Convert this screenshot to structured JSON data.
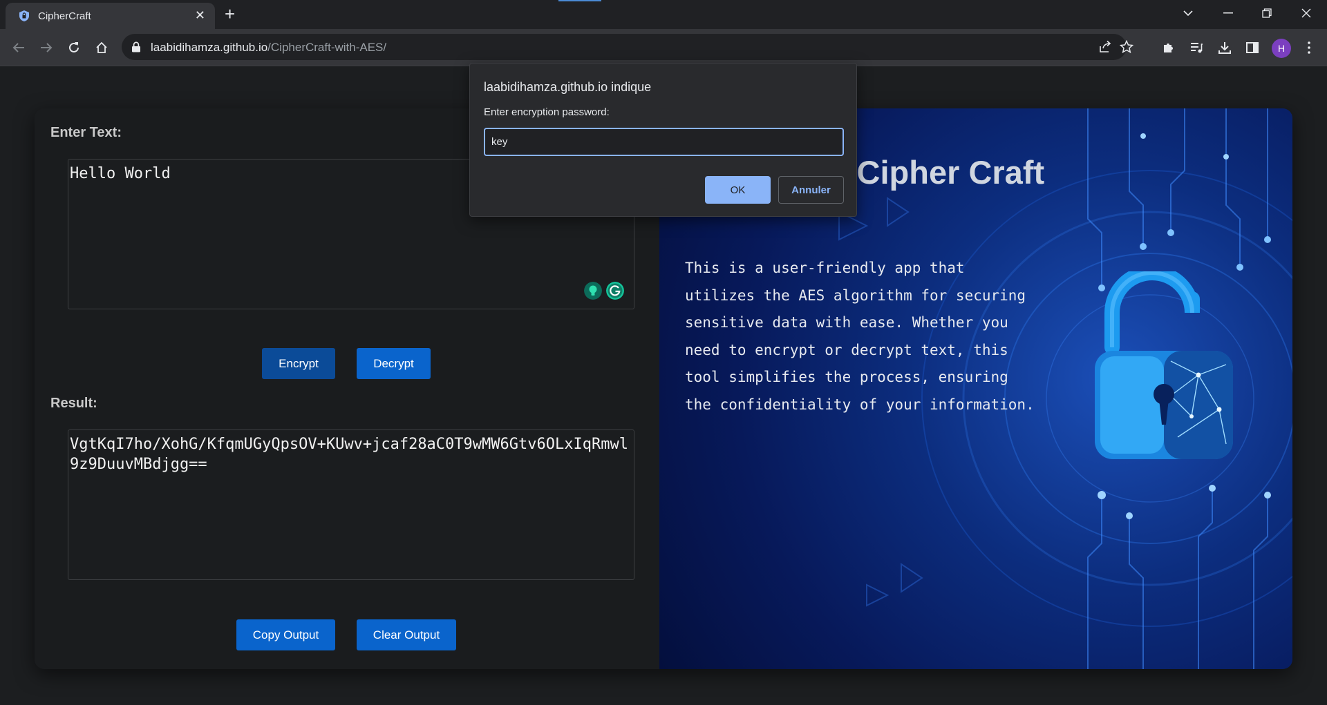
{
  "browser": {
    "tab_title": "CipherCraft",
    "url_host": "laabidihamza.github.io",
    "url_path": "/CipherCraft-with-AES/",
    "profile_initial": "H"
  },
  "app": {
    "input_label": "Enter Text:",
    "input_value": "Hello World",
    "encrypt_label": "Encrypt",
    "decrypt_label": "Decrypt",
    "result_label": "Result:",
    "result_value": "VgtKqI7ho/XohG/KfqmUGyQpsOV+KUwv+jcaf28aC0T9wMW6Gtv6OLxIqRmwl9z9DuuvMBdjgg==",
    "copy_label": "Copy Output",
    "clear_label": "Clear Output",
    "hero_title": "Welcome To Cipher Craft",
    "hero_text": "This is a user-friendly app that utilizes the AES algorithm for securing sensitive data with ease. Whether you need to encrypt or decrypt text, this tool simplifies the process, ensuring the confidentiality of your information."
  },
  "dialog": {
    "title": "laabidihamza.github.io indique",
    "message": "Enter encryption password:",
    "value": "key",
    "ok_label": "OK",
    "cancel_label": "Annuler"
  },
  "colors": {
    "accent": "#0a64cc",
    "dialog_accent": "#8ab4f8"
  }
}
